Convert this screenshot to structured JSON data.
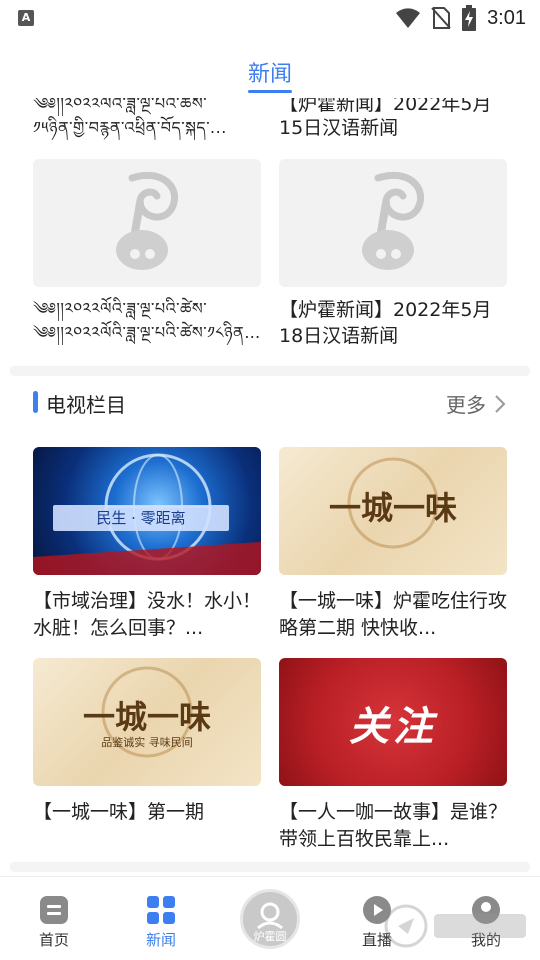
{
  "status_bar": {
    "time": "3:01",
    "left_icon": "A"
  },
  "header": {
    "title": "新闻"
  },
  "news": {
    "top_partial": [
      {
        "text": "༡༥ཉིན་གྱི་བརྙན་འཕྲིན་བོད་སྐད་..."
      },
      {
        "text": "15日汉语新闻"
      }
    ],
    "items": [
      {
        "text": "༄༅།།༢༠༢༢ལོའི་ཟླ་ལྔ་པའི་ཚེས་༡༨ཉིན་གྱི་བརྙན་འཕྲིན་བོད་སྐད་..."
      },
      {
        "text": "【炉霍新闻】2022年5月18日汉语新闻"
      }
    ]
  },
  "tv_section": {
    "title": "电视栏目",
    "more": "更多",
    "items": [
      {
        "text": "【市域治理】没水！水小！水脏！怎么回事？...",
        "overlay": "民生 · 零距离"
      },
      {
        "text": "【一城一味】炉霍吃住行攻略第二期 快快收...",
        "overlay": "一城一味"
      },
      {
        "text": "【一城一味】第一期",
        "overlay": "一城一味",
        "sub": "品鉴诚实 寻味民间"
      },
      {
        "text": "【一人一咖一故事】是谁？带领上百牧民靠上...",
        "overlay": "关注"
      }
    ]
  },
  "tabbar": {
    "tabs": [
      {
        "label": "首页"
      },
      {
        "label": "新闻"
      },
      {
        "label": "炉霍圆"
      },
      {
        "label": "直播"
      },
      {
        "label": "我的"
      }
    ]
  },
  "colors": {
    "accent": "#3d7ef0",
    "tv_red": "#c8262a"
  }
}
